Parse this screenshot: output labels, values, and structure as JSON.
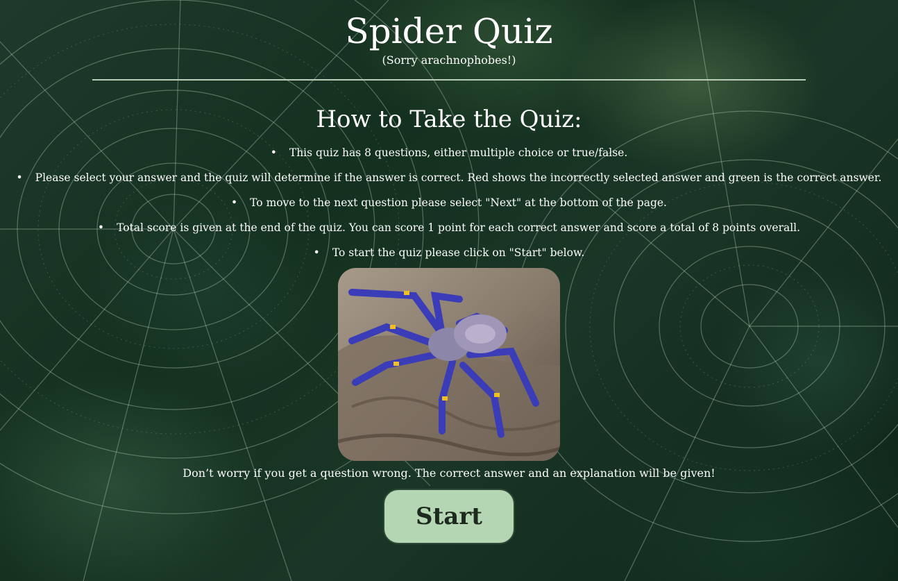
{
  "header": {
    "title": "Spider Quiz",
    "subtitle": "(Sorry arachnophobes!)"
  },
  "instructions": {
    "heading": "How to Take the Quiz:",
    "items": [
      "This quiz has 8 questions, either multiple choice or true/false.",
      "Please select your answer and the quiz will determine if the answer is correct. Red shows the incorrectly selected answer and green is the correct answer.",
      "To move to the next question please select \"Next\" at the bottom of the page.",
      "Total score is given at the end of the quiz. You can score 1 point for each correct answer and score a total of 8 points overall.",
      "To start the quiz please click on \"Start\" below."
    ]
  },
  "note": "Don’t worry if you get a question wrong. The correct answer and an explanation will be given!",
  "start_button": {
    "label": "Start"
  },
  "colors": {
    "button_bg": "#b4d6b2",
    "divider": "#b9cdb9",
    "text": "#ffffff"
  }
}
